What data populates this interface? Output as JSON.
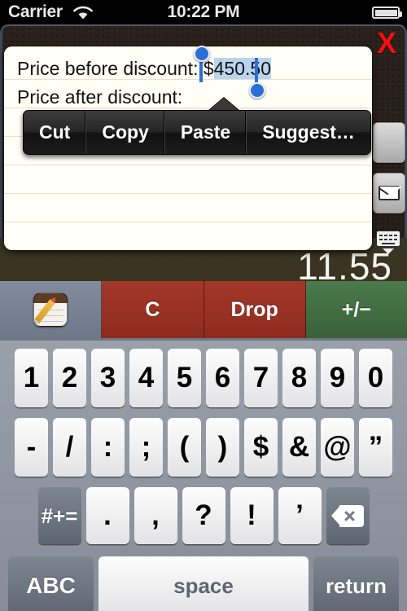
{
  "statusbar": {
    "carrier": "Carrier",
    "time": "10:22 PM",
    "wifi_icon": "wifi-icon",
    "battery_icon": "battery-icon"
  },
  "note": {
    "close_label": "X",
    "line1_prefix": "Price before discount: $",
    "line1_selected": "450.50",
    "line2": "Price after discount:",
    "mail_icon": "envelope-icon",
    "keyboard_dismiss_icon": "keyboard-dismiss-icon"
  },
  "edit_menu": {
    "items": [
      {
        "label": "Cut",
        "name": "cut"
      },
      {
        "label": "Copy",
        "name": "copy"
      },
      {
        "label": "Paste",
        "name": "paste"
      },
      {
        "label": "Suggest…",
        "name": "suggest"
      }
    ]
  },
  "calculator": {
    "display": "11.55"
  },
  "app_toolbar": {
    "notes_icon": "notes-pencil-icon",
    "clear_label": "C",
    "drop_label": "Drop",
    "sign_label": "+/−",
    "colors": {
      "notes_bg": "#7a8496",
      "clear_bg": "#9e3124",
      "drop_bg": "#9e3124",
      "sign_bg": "#3f6b40"
    }
  },
  "keyboard": {
    "row1": [
      "1",
      "2",
      "3",
      "4",
      "5",
      "6",
      "7",
      "8",
      "9",
      "0"
    ],
    "row2": [
      "-",
      "/",
      ":",
      ";",
      "(",
      ")",
      "$",
      "&",
      "@",
      "”"
    ],
    "row3_symbols_label": "#+=",
    "row3": [
      ".",
      ",",
      "?",
      "!",
      "’"
    ],
    "row3_backspace_icon": "backspace-icon",
    "row4": {
      "abc_label": "ABC",
      "space_label": "space",
      "return_label": "return"
    }
  }
}
